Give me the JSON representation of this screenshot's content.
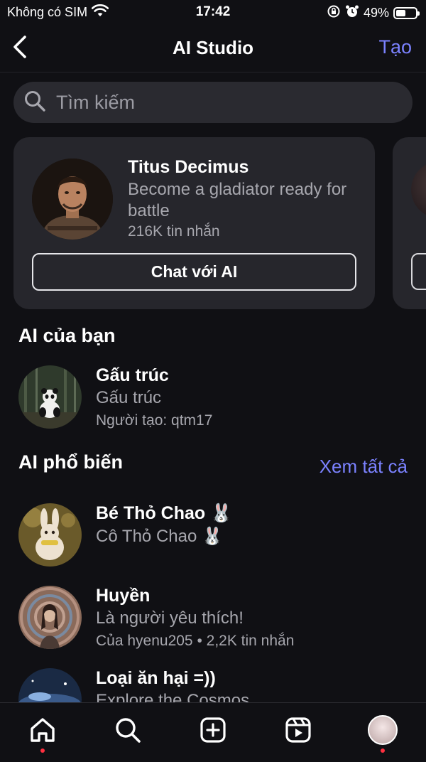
{
  "status_bar": {
    "carrier": "Không có SIM",
    "time": "17:42",
    "battery_percent": "49%",
    "battery_level": 0.49
  },
  "header": {
    "title": "AI Studio",
    "create_label": "Tạo"
  },
  "search": {
    "placeholder": "Tìm kiếm"
  },
  "featured": {
    "name": "Titus Decimus",
    "description": "Become a gladiator ready for battle",
    "messages": "216K tin nhắn",
    "button_label": "Chat với AI"
  },
  "your_ai": {
    "title": "AI của bạn",
    "items": [
      {
        "name": "Gấu trúc",
        "subtitle": "Gấu trúc",
        "meta": "Người tạo: qtm17"
      }
    ]
  },
  "popular_ai": {
    "title": "AI phổ biến",
    "see_all_label": "Xem tất cả",
    "items": [
      {
        "name": "Bé Thỏ Chao 🐰",
        "subtitle": "Cô Thỏ Chao 🐰",
        "meta": ""
      },
      {
        "name": "Huyền",
        "subtitle": "Là người yêu thích!",
        "meta": "Của hyenu205 • 2,2K tin nhắn"
      },
      {
        "name": "Loại ăn hại =))",
        "subtitle": "Explore the Cosmos",
        "meta": ""
      }
    ]
  },
  "colors": {
    "background": "#101014",
    "card": "#26262c",
    "accent": "#7b82ff",
    "notification_dot": "#ff3040"
  },
  "tab_bar": {
    "tabs": [
      "home-icon",
      "search-icon",
      "create-icon",
      "reels-icon",
      "profile-avatar"
    ]
  }
}
